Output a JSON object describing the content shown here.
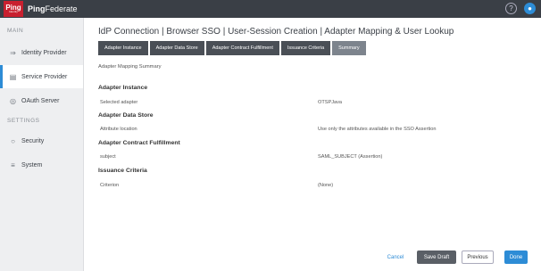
{
  "topbar": {
    "logo_main": "Ping",
    "logo_sub": "Identity",
    "brand_main": "Ping",
    "brand_product": "Federate",
    "help_icon": "help-icon",
    "user_icon": "user-icon"
  },
  "sidebar": {
    "main_label": "MAIN",
    "settings_label": "SETTINGS",
    "items": [
      {
        "label": "Identity Provider",
        "icon": "identity-provider-icon"
      },
      {
        "label": "Service Provider",
        "icon": "service-provider-icon"
      },
      {
        "label": "OAuth Server",
        "icon": "oauth-server-icon"
      },
      {
        "label": "Security",
        "icon": "lock-icon"
      },
      {
        "label": "System",
        "icon": "system-icon"
      }
    ]
  },
  "page": {
    "title": "IdP Connection | Browser SSO | User-Session Creation | Adapter Mapping & User Lookup"
  },
  "tabs": [
    {
      "label": "Adapter Instance"
    },
    {
      "label": "Adapter Data Store"
    },
    {
      "label": "Adapter Contract Fulfillment"
    },
    {
      "label": "Issuance Criteria"
    },
    {
      "label": "Summary"
    }
  ],
  "summary": {
    "heading": "Adapter Mapping Summary",
    "sections": [
      {
        "title": "Adapter Instance",
        "label": "Selected adapter",
        "value": "OTSPJava"
      },
      {
        "title": "Adapter Data Store",
        "label": "Attribute location",
        "value": "Use only the attributes available in the SSO Assertion"
      },
      {
        "title": "Adapter Contract Fulfillment",
        "label": "subject",
        "value": "SAML_SUBJECT (Assertion)"
      },
      {
        "title": "Issuance Criteria",
        "label": "Criterion",
        "value": "(None)"
      }
    ]
  },
  "footer": {
    "cancel": "Cancel",
    "save_draft": "Save Draft",
    "previous": "Previous",
    "done": "Done"
  },
  "colors": {
    "accent": "#2d8cd6",
    "topbar": "#3a3f46",
    "logo": "#c8202f"
  }
}
